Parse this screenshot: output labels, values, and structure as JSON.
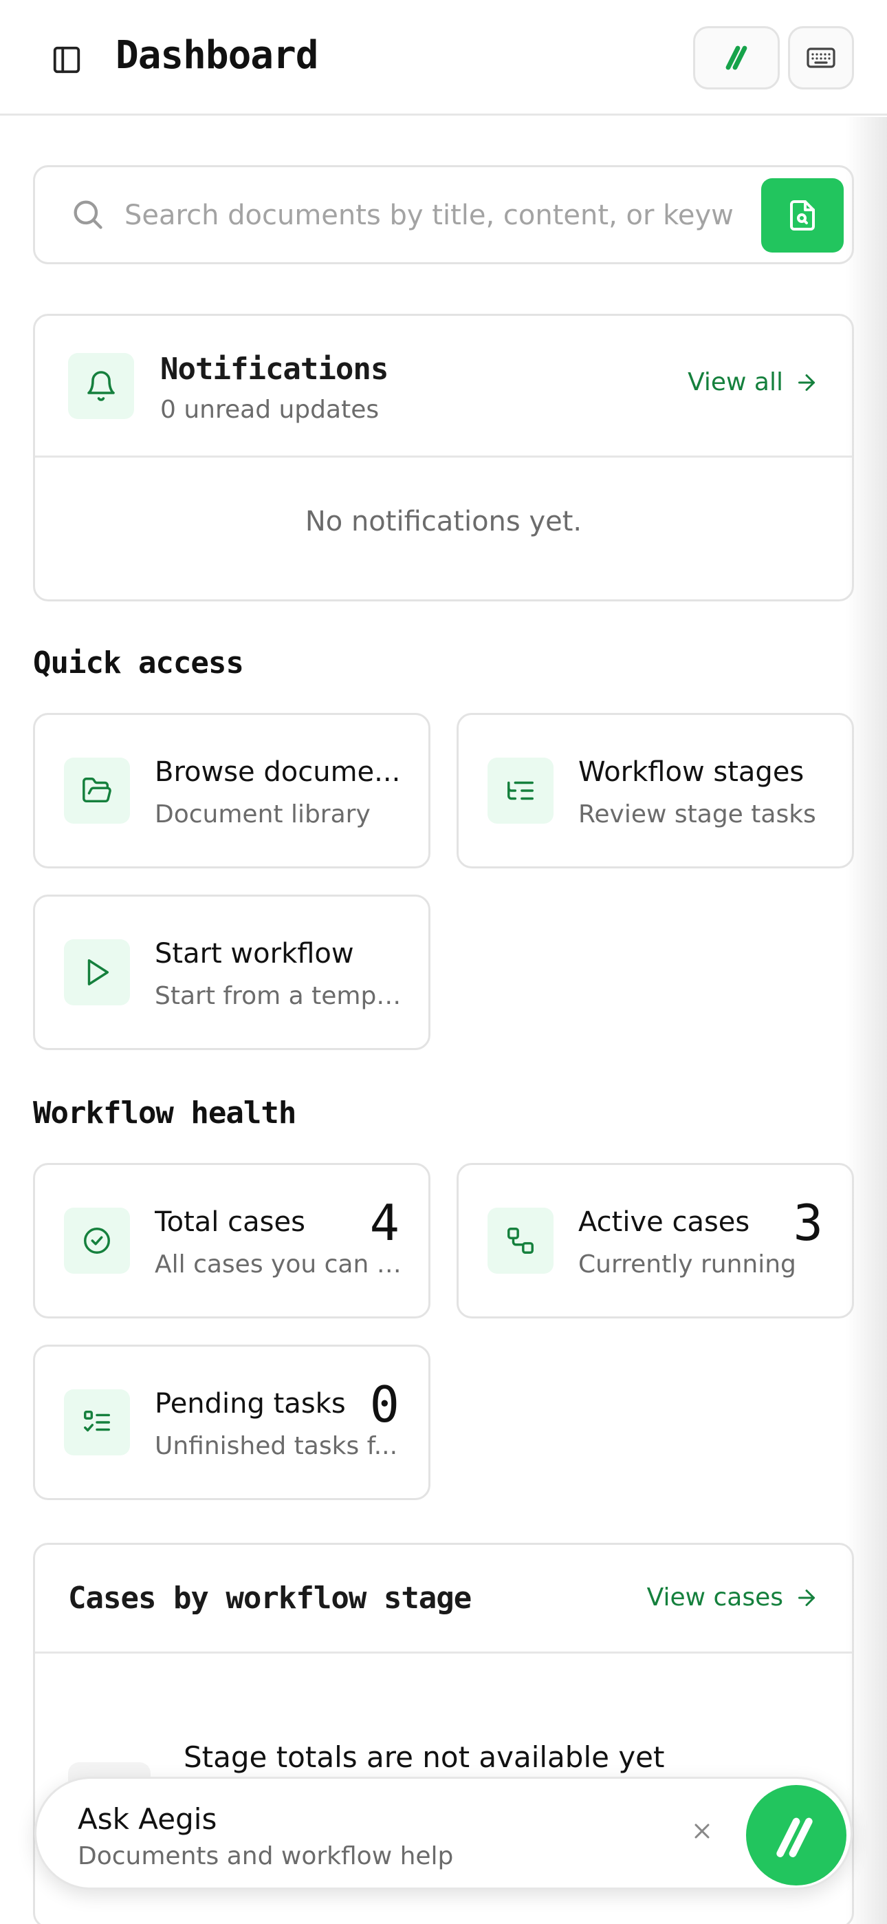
{
  "header": {
    "title": "Dashboard",
    "icons": {
      "sidebar": "sidebar-toggle-icon",
      "brand": "aegis-logo-icon",
      "keyboard": "keyboard-icon"
    }
  },
  "search": {
    "placeholder": "Search documents by title, content, or keyw",
    "value": ""
  },
  "notifications": {
    "title": "Notifications",
    "subtitle": "0 unread updates",
    "view_all": "View all",
    "empty": "No notifications yet."
  },
  "quick_access": {
    "title": "Quick access",
    "items": [
      {
        "label": "Browse docume...",
        "sub": "Document library",
        "icon": "folder-open-icon"
      },
      {
        "label": "Workflow stages",
        "sub": "Review stage tasks",
        "icon": "list-tree-icon"
      },
      {
        "label": "Start workflow",
        "sub": "Start from a templ...",
        "icon": "play-icon"
      }
    ]
  },
  "workflow_health": {
    "title": "Workflow health",
    "items": [
      {
        "label": "Total cases",
        "sub": "All cases you can a...",
        "value": "4",
        "icon": "check-circle-icon"
      },
      {
        "label": "Active cases",
        "sub": "Currently running",
        "value": "3",
        "icon": "workflow-icon"
      },
      {
        "label": "Pending tasks",
        "sub": "Unfinished tasks f...",
        "value": "0",
        "icon": "list-checks-icon"
      }
    ]
  },
  "stage_cases": {
    "title": "Cases by workflow stage",
    "view_cases": "View cases",
    "empty": "Stage totals are not available yet"
  },
  "ask": {
    "title": "Ask Aegis",
    "subtitle": "Documents and workflow help"
  },
  "colors": {
    "accent": "#22c55e",
    "accent_text": "#15803d",
    "tile_bg": "#eafaf0",
    "border": "#e3e3e3",
    "muted": "#6b6b6b"
  }
}
